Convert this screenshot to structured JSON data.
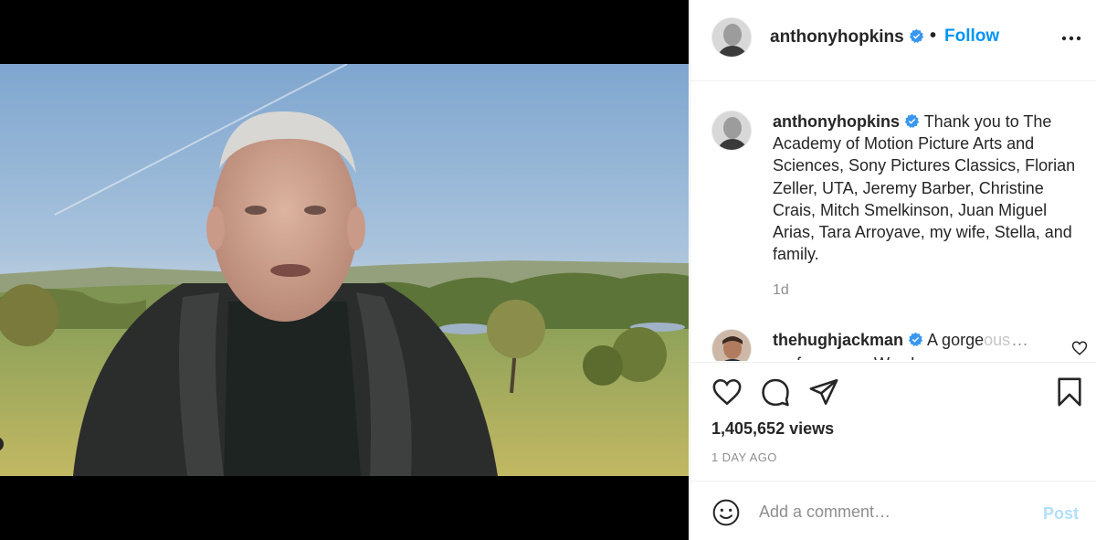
{
  "post": {
    "author": "anthonyhopkins",
    "follow_separator": "•",
    "follow_label": "Follow"
  },
  "caption": {
    "author": "anthonyhopkins",
    "text": "Thank you to The Academy of Motion Picture Arts and Sciences, Sony Pictures Classics, Florian Zeller, UTA, Jeremy Barber, Christine Crais, Mitch Smelkinson, Juan Miguel Arias, Tara Arroyave, my wife, Stella, and family.",
    "time": "1d"
  },
  "comment": {
    "author": "thehughjackman",
    "text_visible": "A gorge",
    "text_faded": "ous",
    "more": "...",
    "next_line": "performance. Wow!"
  },
  "stats": {
    "views": "1,405,652 views",
    "date": "1 DAY AGO"
  },
  "composer": {
    "placeholder": "Add a comment…",
    "post_label": "Post"
  },
  "colors": {
    "accent": "#0095f6",
    "post_disabled": "#b2dffc",
    "verified": "#3897f0"
  },
  "icons": {
    "mute": "speaker-muted-icon",
    "like": "heart-icon",
    "comment": "comment-bubble-icon",
    "share": "paper-plane-icon",
    "save": "bookmark-icon",
    "emoji": "smiley-icon",
    "more": "more-dots-icon",
    "verified": "verified-badge-icon"
  }
}
